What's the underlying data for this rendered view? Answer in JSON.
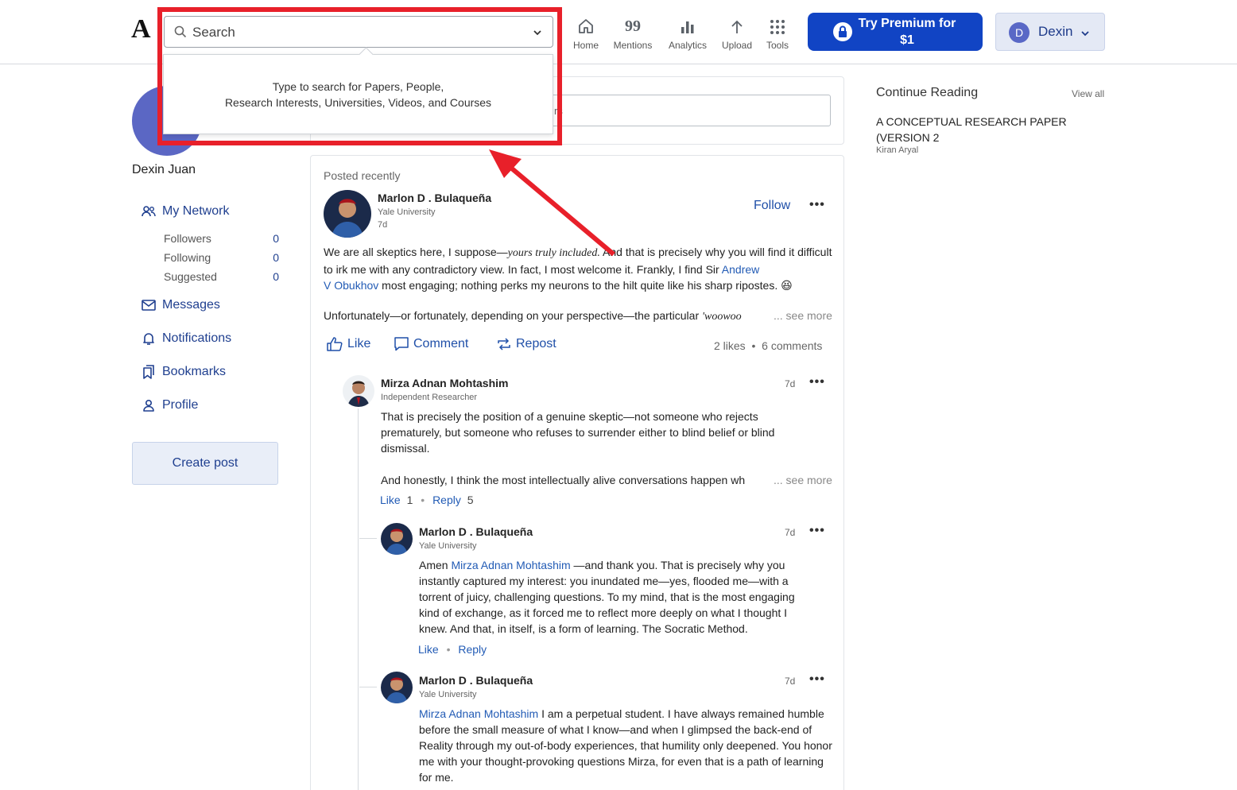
{
  "header": {
    "logo": "A",
    "search_placeholder": "Search",
    "nav": [
      {
        "label": "Home",
        "icon": "home-icon"
      },
      {
        "label": "Mentions",
        "icon": "mentions-icon"
      },
      {
        "label": "Analytics",
        "icon": "analytics-icon"
      },
      {
        "label": "Upload",
        "icon": "upload-icon"
      },
      {
        "label": "Tools",
        "icon": "tools-icon"
      }
    ],
    "mentions_glyph": "99",
    "premium_line1": "Try Premium for",
    "premium_line2": "$1",
    "user_initial": "D",
    "user_name": "Dexin"
  },
  "search_dropdown": {
    "line1": "Type to search for Papers, People,",
    "line2": "Research Interests, Universities, Videos, and Courses"
  },
  "annotation_color": "#e8202a",
  "sidebar": {
    "profile_name": "Dexin Juan",
    "my_network": "My Network",
    "network_rows": [
      {
        "label": "Followers",
        "count": "0"
      },
      {
        "label": "Following",
        "count": "0"
      },
      {
        "label": "Suggested",
        "count": "0"
      }
    ],
    "links": [
      "Messages",
      "Notifications",
      "Bookmarks",
      "Profile"
    ],
    "create_post": "Create post"
  },
  "composer": {
    "placeholder_fragment": "rs"
  },
  "post": {
    "section_label": "Posted recently",
    "author": "Marlon D . Bulaqueña",
    "affiliation": "Yale University",
    "age": "7d",
    "follow": "Follow",
    "line1_a": "We are all skeptics here, I suppose—",
    "line1_italic": "yours truly included.",
    "line1_b": " And that is precisely why you will find it",
    "line2": "difficult to irk me with any contradictory view. In fact, I most welcome it. Frankly, I find Sir ",
    "mention1_a": "Andrew",
    "mention1_b": "V Obukhov",
    "line3": " most engaging; nothing perks my neurons to the hilt quite like his sharp ripostes. ",
    "emoji": "😆",
    "line4": "Unfortunately—or fortunately, depending on your perspective—the particular ",
    "line4_italic": "'woowoo",
    "see_more": "... see more",
    "actions": {
      "like": "Like",
      "comment": "Comment",
      "repost": "Repost"
    },
    "stats": {
      "likes": "2 likes",
      "comments": "6 comments"
    }
  },
  "comments": [
    {
      "author": "Mirza Adnan Mohtashim",
      "affiliation": "Independent Researcher",
      "age": "7d",
      "text": "That is precisely the position of a genuine skeptic—not someone who rejects prematurely, but someone who refuses to surrender either to blind belief or blind dismissal.",
      "text2": "And honestly, I think the most intellectually alive conversations happen wh",
      "see_more": "... see more",
      "like": "Like",
      "like_count": "1",
      "reply": "Reply",
      "reply_count": "5"
    },
    {
      "author": "Marlon D . Bulaqueña",
      "affiliation": "Yale University",
      "age": "7d",
      "mention": "Mirza Adnan Mohtashim",
      "text": " —and thank you. That is precisely why you instantly captured my interest: you inundated me—yes, flooded me—with a torrent of juicy, challenging questions. To my mind, that is the most engaging kind of exchange, as it forced me to reflect more deeply on what I thought I knew. And that, in itself, is a form of learning. The Socratic Method.",
      "prefix": "Amen ",
      "like": "Like",
      "reply": "Reply"
    },
    {
      "author": "Marlon D . Bulaqueña",
      "affiliation": "Yale University",
      "age": "7d",
      "mention": "Mirza Adnan Mohtashim",
      "text": " I am a perpetual student. I have always remained humble before the small measure of what I know—and when I glimpsed the back-end of Reality through my out-of-body experiences, that humility only deepened. You honor me with your thought-provoking questions Mirza, for even that is a path of learning for me."
    }
  ],
  "continue_reading": {
    "title": "Continue Reading",
    "view_all": "View all",
    "paper_title": "A CONCEPTUAL RESEARCH PAPER (VERSION 2",
    "paper_author": "Kiran Aryal"
  }
}
